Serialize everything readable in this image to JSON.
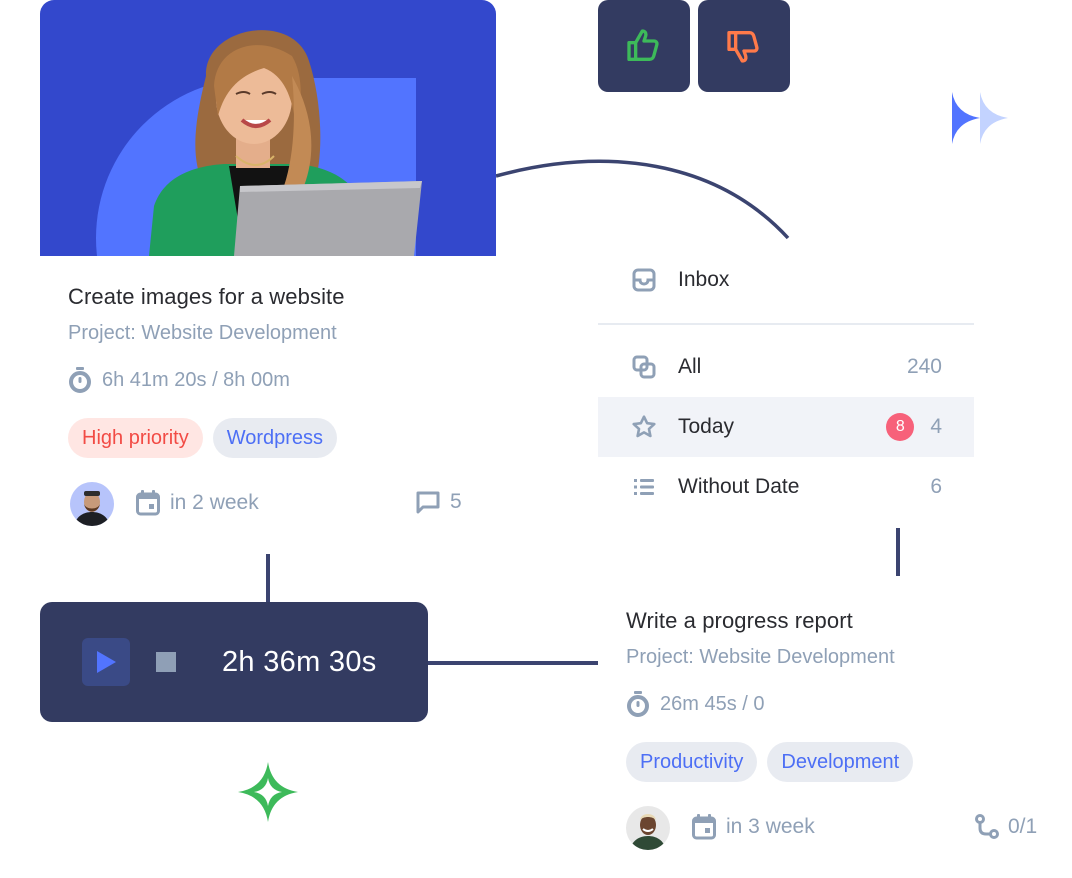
{
  "reactions": {
    "like_icon": "thumbs-up-icon",
    "dislike_icon": "thumbs-down-icon",
    "like_color": "#3dba5a",
    "dislike_color": "#ff7a4a"
  },
  "card1": {
    "title": "Create images for a website",
    "project": "Project: Website Development",
    "time": "6h 41m 20s / 8h 00m",
    "tags": [
      "High priority",
      "Wordpress"
    ],
    "due": "in 2 week",
    "comments": "5"
  },
  "list": {
    "inbox": "Inbox",
    "items": [
      {
        "label": "All",
        "count": "240"
      },
      {
        "label": "Today",
        "badge": "8",
        "count": "4"
      },
      {
        "label": "Without Date",
        "count": "6"
      }
    ]
  },
  "timer": {
    "value": "2h 36m 30s"
  },
  "card2": {
    "title": "Write a progress report",
    "project": "Project: Website Development",
    "time": "26m 45s / 0",
    "tags": [
      "Productivity",
      "Development"
    ],
    "due": "in 3 week",
    "subtasks": "0/1"
  },
  "colors": {
    "navy": "#333b61",
    "brand_blue": "#3348cc",
    "accent_blue": "#5274ff",
    "muted": "#8fa0b6",
    "badge_red": "#f7617a",
    "sparkle_green": "#3dba5a"
  }
}
